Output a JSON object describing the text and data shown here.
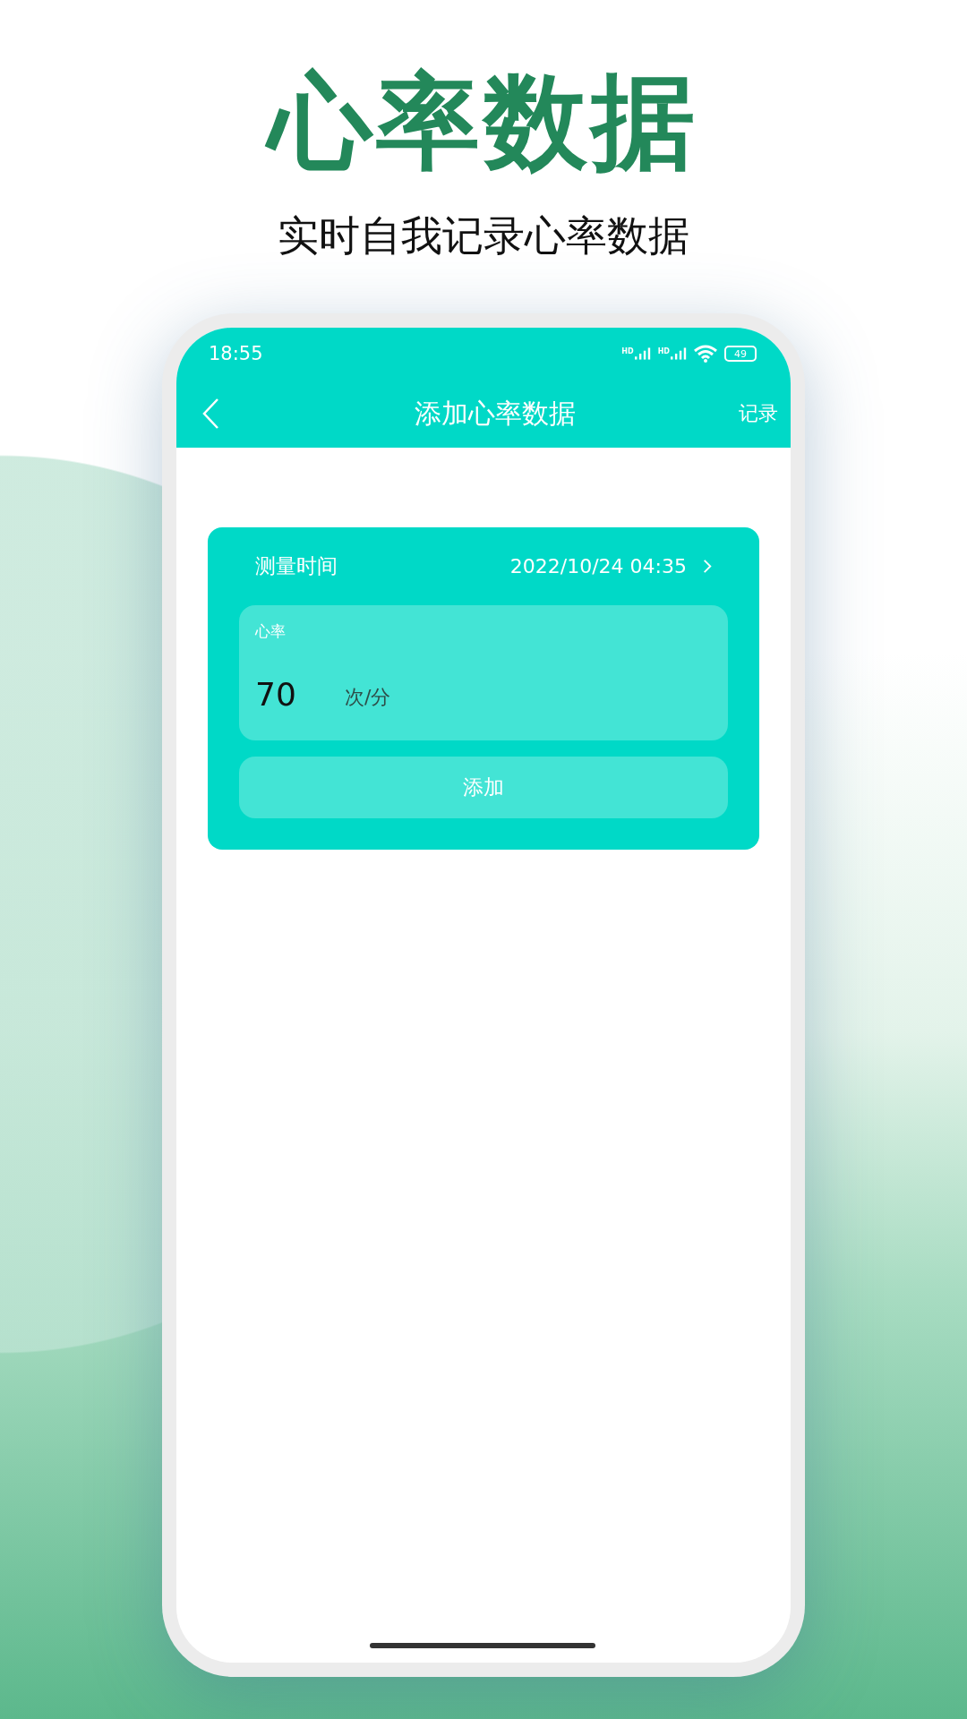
{
  "promo": {
    "headline": "心率数据",
    "subtitle": "实时自我记录心率数据"
  },
  "status_bar": {
    "time": "18:55",
    "network_labels": [
      "HD",
      "HD"
    ],
    "battery": "49"
  },
  "header": {
    "title": "添加心率数据",
    "action": "记录"
  },
  "form": {
    "time_label": "测量时间",
    "time_value": "2022/10/24 04:35",
    "field_label": "心率",
    "value": "70",
    "unit": "次/分",
    "button": "添加"
  }
}
